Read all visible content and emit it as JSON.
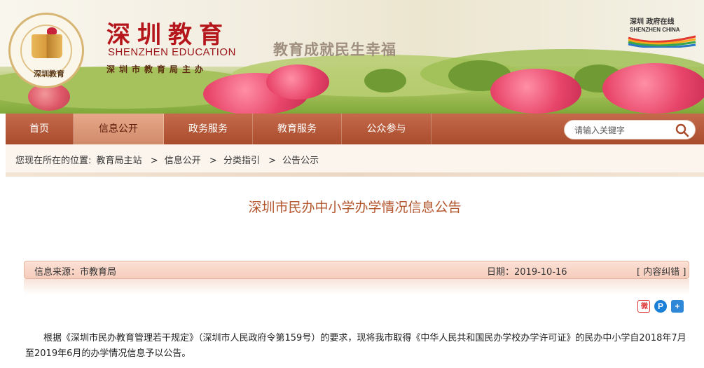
{
  "header": {
    "logo_text": "深圳教育",
    "title_cn": "深圳教育",
    "title_en": "SHENZHEN EDUCATION",
    "subtitle": "深圳市教育局主办",
    "slogan": "教育成就民生幸福",
    "partner_logo_cn": "深圳 政府在线",
    "partner_logo_en": "SHENZHEN CHINA"
  },
  "nav": {
    "items": [
      {
        "label": "首页",
        "active": false
      },
      {
        "label": "信息公开",
        "active": true
      },
      {
        "label": "政务服务",
        "active": false
      },
      {
        "label": "教育服务",
        "active": false
      },
      {
        "label": "公众参与",
        "active": false
      }
    ],
    "search_placeholder": "请输入关键字"
  },
  "breadcrumb": {
    "prefix": "您现在所在的位置:",
    "items": [
      "教育局主站",
      "信息公开",
      "分类指引",
      "公告公示"
    ],
    "separator": ">"
  },
  "article": {
    "title": "深圳市民办中小学办学情况信息公告",
    "source": "信息来源：市教育局",
    "date": "日期：2019-10-16",
    "correction": "[ 内容纠错 ]",
    "body": "根据《深圳市民办教育管理若干规定》（深圳市人民政府令第159号）的要求，现将我市取得《中华人民共和国民办学校办学许可证》的民办中小学自2018年7月至2019年6月的办学情况信息予以公告。"
  },
  "share": {
    "icons": [
      "weibo-icon",
      "pinterest-icon",
      "plus-icon"
    ]
  },
  "colors": {
    "brand_red": "#b5161b",
    "nav_bg": "#a84c2d",
    "nav_active": "#e7a889",
    "title_color": "#b3552d"
  }
}
